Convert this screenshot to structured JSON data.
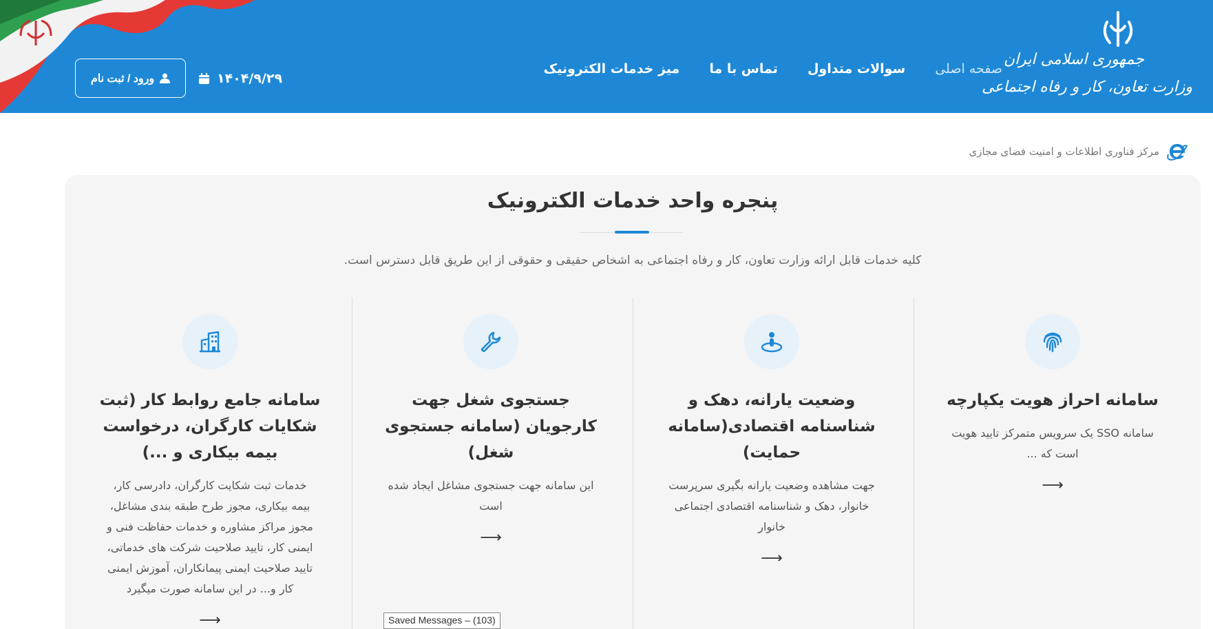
{
  "header": {
    "brand_line1": "جمهوری اسلامی ایران",
    "brand_line2": "وزارت تعاون، کار و رفاه اجتماعی",
    "nav": [
      {
        "label": "صفحه اصلی",
        "active": true
      },
      {
        "label": "سوالات متداول",
        "active": false
      },
      {
        "label": "تماس با ما",
        "active": false
      },
      {
        "label": "میز خدمات الکترونیک",
        "active": false
      }
    ],
    "date": "۱۴۰۴/۹/۲۹",
    "login_label": "ورود / ثبت نام",
    "bg_color": "#1e88d6"
  },
  "subheader": {
    "it_center": "مرکز فناوری اطلاعات و امنیت فضای مجازی"
  },
  "main": {
    "title": "پنجره واحد خدمات الکترونیک",
    "description": "کلیه خدمات قابل ارائه وزارت تعاون، کار و رفاه اجتماعی به اشخاص حقیقی و حقوقی از این طریق قابل دسترس است.",
    "accent_color": "#1e88d6",
    "cards": [
      {
        "icon": "fingerprint-icon",
        "title": "سامانه احراز هویت یکپارچه",
        "desc": "سامانه SSO یک سرویس متمرکز تایید هویت است که ...",
        "arrow": "⟶"
      },
      {
        "icon": "person-location-icon",
        "title": "وضعیت یارانه، دهک و شناسنامه اقتصادی(سامانه حمایت)",
        "desc": "جهت مشاهده وضعیت یارانه بگیری سرپرست خانوار، دهک و شناسنامه اقتصادی اجتماعی خانوار",
        "arrow": "⟶"
      },
      {
        "icon": "wrench-icon",
        "title": "جستجوی شغل جهت کارجویان (سامانه جستجوی شغل)",
        "desc": "این سامانه جهت جستجوی مشاغل ایجاد شده است",
        "arrow": "⟶"
      },
      {
        "icon": "building-icon",
        "title": "سامانه جامع روابط کار (ثبت شکایات کارگران، درخواست بیمه بیکاری و ...)",
        "desc": "خدمات ثبت شکایت کارگران، دادرسی کار، بیمه بیکاری، مجوز طرح طبقه بندی مشاغل، مجوز مراکز مشاوره و خدمات حفاظت فنی و ایمنی کار، تایید صلاحیت شرکت های خدماتی، تایید صلاحیت ایمنی پیمانکاران، آموزش ایمنی کار و... در این سامانه صورت میگیرد",
        "arrow": "⟶"
      }
    ]
  },
  "tooltip": {
    "text": "Saved Messages – (103)"
  }
}
